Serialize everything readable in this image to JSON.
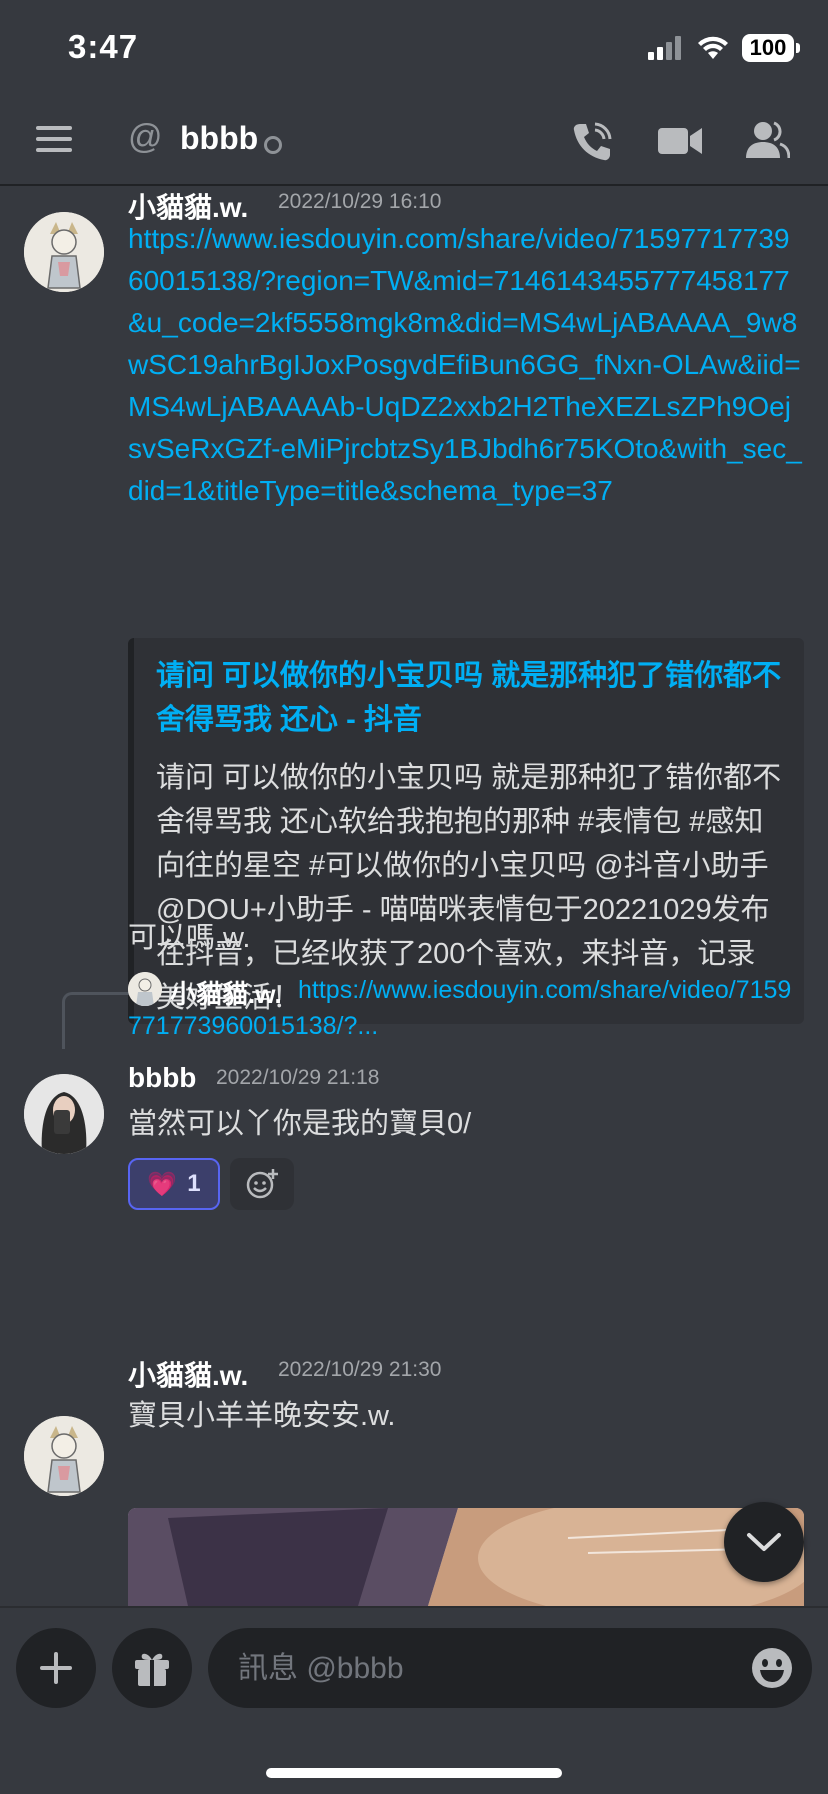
{
  "status_bar": {
    "time": "3:47",
    "battery": "100"
  },
  "header": {
    "at_symbol": "@",
    "username": "bbbb"
  },
  "messages": [
    {
      "author": "小貓貓.w.",
      "timestamp": "2022/10/29 16:10",
      "link": "https://www.iesdouyin.com/share/video/7159771773960015138/?region=TW&mid=7146143455777458177&u_code=2kf5558mgk8m&did=MS4wLjABAAAA_9w8wSC19ahrBgIJoxPosgvdEfiBun6GG_fNxn-OLAw&iid=MS4wLjABAAAAb-UqDZ2xxb2H2TheXEZLsZPh9OejsvSeRxGZf-eMiPjrcbtzSy1BJbdh6r75KOto&with_sec_did=1&titleType=title&schema_type=37",
      "embed": {
        "title": "请问 可以做你的小宝贝吗 就是那种犯了错你都不舍得骂我 还心 - 抖音",
        "description": "请问 可以做你的小宝贝吗 就是那种犯了错你都不舍得骂我 还心软给我抱抱的那种 #表情包 #感知向往的星空 #可以做你的小宝贝吗 @抖音小助手 @DOU+小助手 - 喵喵咪表情包于20221029发布在抖音，已经收获了200个喜欢，来抖音，记录美好生活！"
      },
      "text": "可以嗎.w."
    },
    {
      "reply_to": {
        "author": "小貓貓.w.",
        "preview": "https://www.iesdouyin.com/share/video/7159771773960015138/?..."
      },
      "author": "bbbb",
      "timestamp": "2022/10/29 21:18",
      "text": "當然可以丫你是我的寶貝0/",
      "reaction": {
        "emoji": "💗",
        "count": "1"
      }
    },
    {
      "author": "小貓貓.w.",
      "timestamp": "2022/10/29 21:30",
      "text": "寶貝小羊羊晚安安.w."
    }
  ],
  "composer": {
    "placeholder": "訊息 @bbbb"
  },
  "colors": {
    "background": "#36393f",
    "link": "#00aff4",
    "reaction_accent": "#5865f2"
  }
}
